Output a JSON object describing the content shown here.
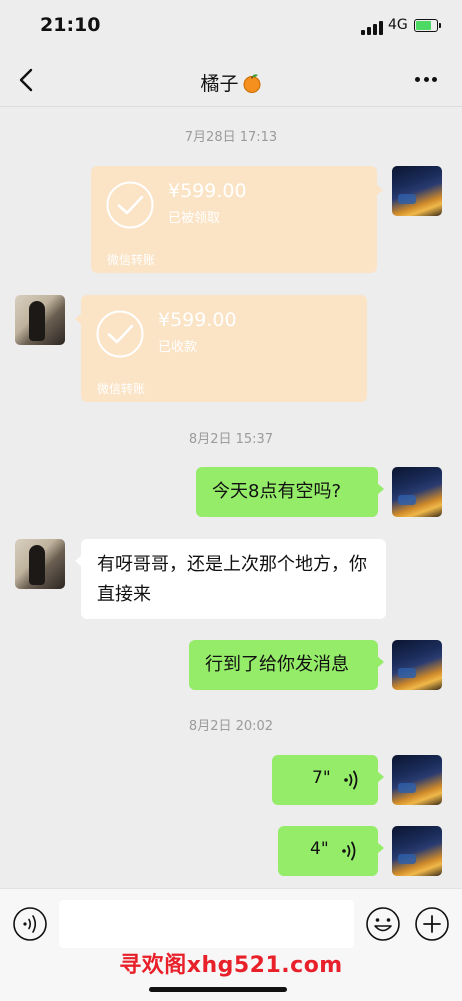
{
  "status": {
    "time": "21:10",
    "network": "4G"
  },
  "header": {
    "title": "橘子"
  },
  "messages": {
    "ts1": "7月28日 17:13",
    "transfer1": {
      "amount": "¥599.00",
      "status": "已被领取",
      "brand": "微信转账"
    },
    "transfer2": {
      "amount": "¥599.00",
      "status": "已收款",
      "brand": "微信转账"
    },
    "ts2": "8月2日 15:37",
    "msg1": "今天8点有空吗?",
    "msg2": "有呀哥哥，还是上次那个地方，你直接来",
    "msg3": "行到了给你发消息",
    "ts3": "8月2日 20:02",
    "voice1": "7\"",
    "voice2": "4\""
  },
  "input": {
    "placeholder": ""
  },
  "watermark": "寻欢阁xhg521.com",
  "colors": {
    "bubble_green": "#95ec69",
    "transfer": "#fbe3c5",
    "watermark": "#e8202a"
  }
}
